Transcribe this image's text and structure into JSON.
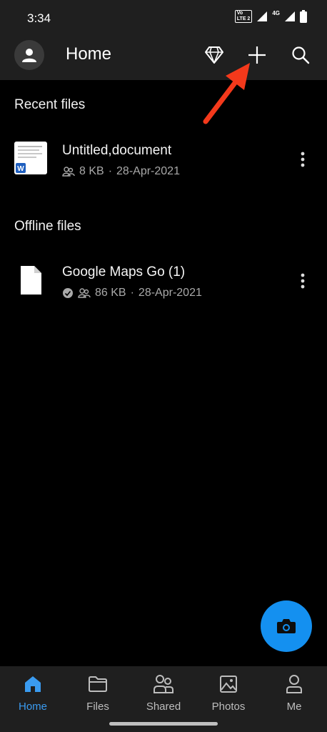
{
  "status": {
    "time": "3:34",
    "volte_line1": "Vo",
    "volte_line2": "LTE 2",
    "network": "4G"
  },
  "appbar": {
    "title": "Home"
  },
  "sections": {
    "recent_title": "Recent files",
    "offline_title": "Offline files"
  },
  "recent_files": [
    {
      "name": "Untitled,document",
      "size": "8 KB",
      "date": "28-Apr-2021",
      "type": "word"
    }
  ],
  "offline_files": [
    {
      "name": "Google Maps Go (1)",
      "size": "86 KB",
      "date": "28-Apr-2021",
      "type": "file"
    }
  ],
  "nav": [
    {
      "label": "Home",
      "icon": "home-icon"
    },
    {
      "label": "Files",
      "icon": "folder-icon"
    },
    {
      "label": "Shared",
      "icon": "shared-people-icon"
    },
    {
      "label": "Photos",
      "icon": "photo-icon"
    },
    {
      "label": "Me",
      "icon": "person-icon"
    }
  ],
  "colors": {
    "accent": "#1490f0",
    "annotation_arrow": "#f4391b",
    "bar_bg": "#1f1f1f"
  }
}
